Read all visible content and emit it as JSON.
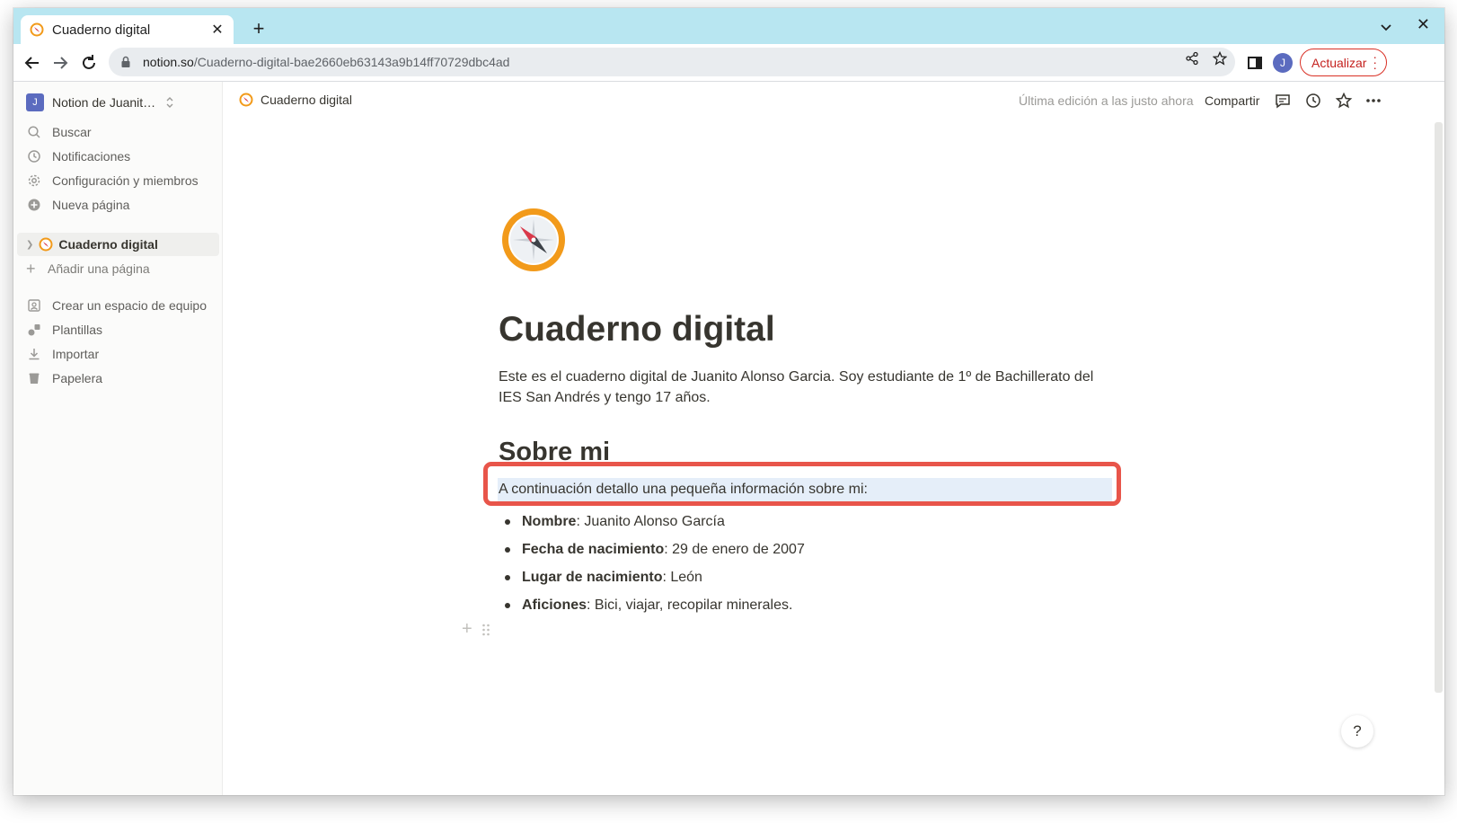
{
  "browser": {
    "tab_title": "Cuaderno digital",
    "tab_close": "✕",
    "new_tab": "+",
    "window_close": "✕",
    "url_domain": "notion.so",
    "url_path": "/Cuaderno-digital-bae2660eb63143a9b14ff70729dbc4ad",
    "profile_initial": "J",
    "update_label": "Actualizar",
    "accent_color": "#b8e6f1",
    "update_color": "#d93025"
  },
  "sidebar": {
    "workspace_initial": "J",
    "workspace_name": "Notion de Juanit…",
    "items": [
      {
        "label": "Buscar",
        "icon": "search-icon"
      },
      {
        "label": "Notificaciones",
        "icon": "clock-icon"
      },
      {
        "label": "Configuración y miembros",
        "icon": "gear-icon"
      },
      {
        "label": "Nueva página",
        "icon": "plus-circle-icon"
      }
    ],
    "page": {
      "label": "Cuaderno digital",
      "icon": "compass-icon"
    },
    "add_page": "Añadir una página",
    "bottom_items": [
      {
        "label": "Crear un espacio de equipo",
        "icon": "teamspace-icon"
      },
      {
        "label": "Plantillas",
        "icon": "shapes-icon"
      },
      {
        "label": "Importar",
        "icon": "download-icon"
      },
      {
        "label": "Papelera",
        "icon": "trash-icon"
      }
    ]
  },
  "topbar": {
    "breadcrumb": "Cuaderno digital",
    "edited": "Última edición a las justo ahora",
    "share": "Compartir"
  },
  "page": {
    "title": "Cuaderno digital",
    "intro": "Este es el cuaderno digital de Juanito Alonso Garcia. Soy estudiante de 1º de Bachillerato del IES San Andrés y tengo 17 años.",
    "heading": "Sobre mi",
    "selected_text": "A continuación detallo una pequeña información sobre mi:",
    "bullets": [
      {
        "key": "Nombre",
        "value": ": Juanito Alonso García"
      },
      {
        "key": "Fecha de nacimiento",
        "value": ": 29 de enero de 2007"
      },
      {
        "key": "Lugar de nacimiento",
        "value": ": León"
      },
      {
        "key": "Aficiones",
        "value": ": Bici, viajar, recopilar minerales."
      }
    ],
    "highlight_color": "#e8554a",
    "help": "?"
  }
}
